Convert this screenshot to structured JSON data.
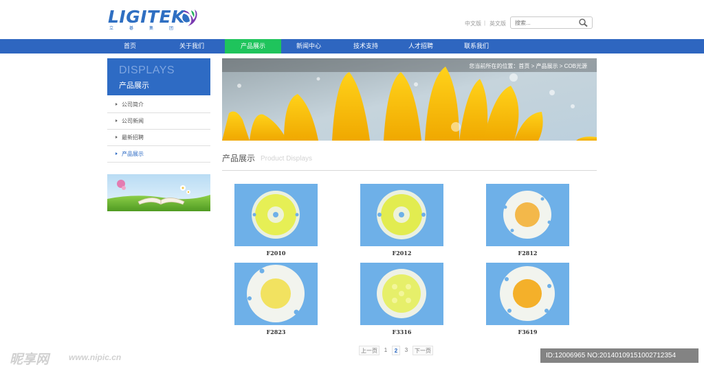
{
  "header": {
    "logo_text": "LIGITEK",
    "logo_sub": "立碁集团",
    "lang_cn": "中文版",
    "lang_sep": "|",
    "lang_en": "英文版",
    "search_placeholder": "搜索..."
  },
  "nav": {
    "items": [
      {
        "label": "首页"
      },
      {
        "label": "关于我们"
      },
      {
        "label": "产品展示"
      },
      {
        "label": "新闻中心"
      },
      {
        "label": "技术支持"
      },
      {
        "label": "人才招聘"
      },
      {
        "label": "联系我们"
      }
    ],
    "active_color": "#1fc45c",
    "bar_color": "#2e66c0"
  },
  "sidebar": {
    "title_en": "DISPLAYS",
    "title_cn": "产品展示",
    "items": [
      {
        "label": "公司简介"
      },
      {
        "label": "公司新闻"
      },
      {
        "label": "最新招聘"
      },
      {
        "label": "产品展示"
      }
    ]
  },
  "banner": {
    "breadcrumb": "您当前所在的位置：首页 > 产品展示 > COB光源"
  },
  "section": {
    "title_cn": "产品展示",
    "title_en": "Product Displays"
  },
  "products": [
    {
      "name": "F2010"
    },
    {
      "name": "F2012"
    },
    {
      "name": "F2812"
    },
    {
      "name": "F2823"
    },
    {
      "name": "F3316"
    },
    {
      "name": "F3619"
    }
  ],
  "pagination": {
    "prev": "上一页",
    "pages": [
      "1",
      "2",
      "3"
    ],
    "current": "2",
    "next": "下一页"
  },
  "watermark": {
    "left": "昵享网",
    "url": "www.nipic.cn",
    "right": "ID:12006965 NO:20140109151002712354"
  }
}
